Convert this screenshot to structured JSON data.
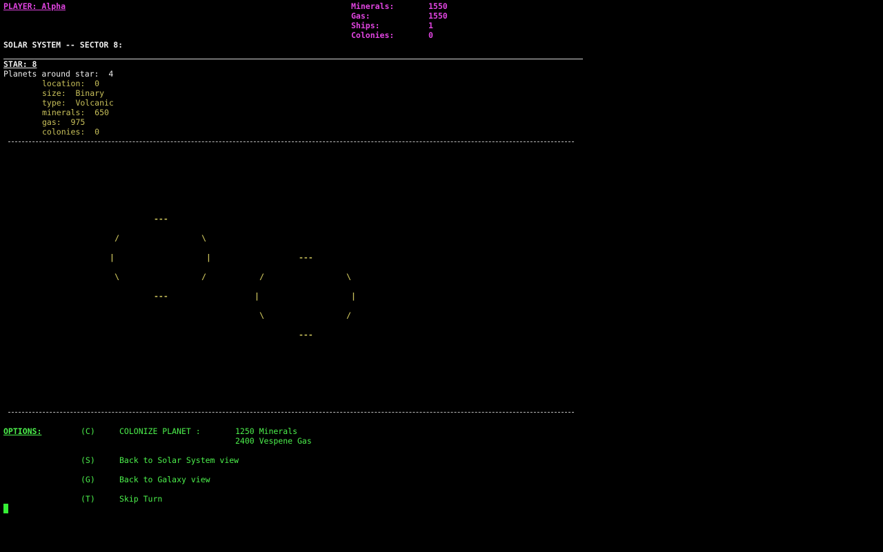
{
  "header": {
    "player_label": "PLAYER: Alpha",
    "resources": [
      {
        "label": "Minerals:",
        "value": "1550"
      },
      {
        "label": "Gas:",
        "value": "1550"
      },
      {
        "label": "Ships:",
        "value": "1"
      },
      {
        "label": "Colonies:",
        "value": "0"
      }
    ]
  },
  "view": {
    "title": "SOLAR SYSTEM -- SECTOR 8:",
    "star_label": "STAR: 8",
    "planets_line": "Planets around star:  4"
  },
  "planet_info": {
    "location": "location:  0",
    "size": "size:  Binary",
    "type": "type:  Volcanic",
    "minerals": "minerals:  650",
    "gas": "gas:  975",
    "colonies": "colonies:  0"
  },
  "ascii_art": {
    "top": "---",
    "bottom": "---",
    "slash": "/",
    "backslash": "\\",
    "pipe": "|"
  },
  "options": {
    "heading": "OPTIONS:",
    "items": [
      {
        "key": "(C)",
        "label": "COLONIZE PLANET :",
        "cost_line1": "1250 Minerals",
        "cost_line2": "2400 Vespene Gas"
      },
      {
        "key": "(S)",
        "label": "Back to Solar System view"
      },
      {
        "key": "(G)",
        "label": "Back to Galaxy view"
      },
      {
        "key": "(T)",
        "label": "Skip Turn"
      }
    ]
  },
  "colors": {
    "background": "#000000",
    "player_stats": "#e044e0",
    "planet_info": "#c8c05a",
    "options": "#4cf04c",
    "cursor": "#36f036"
  }
}
